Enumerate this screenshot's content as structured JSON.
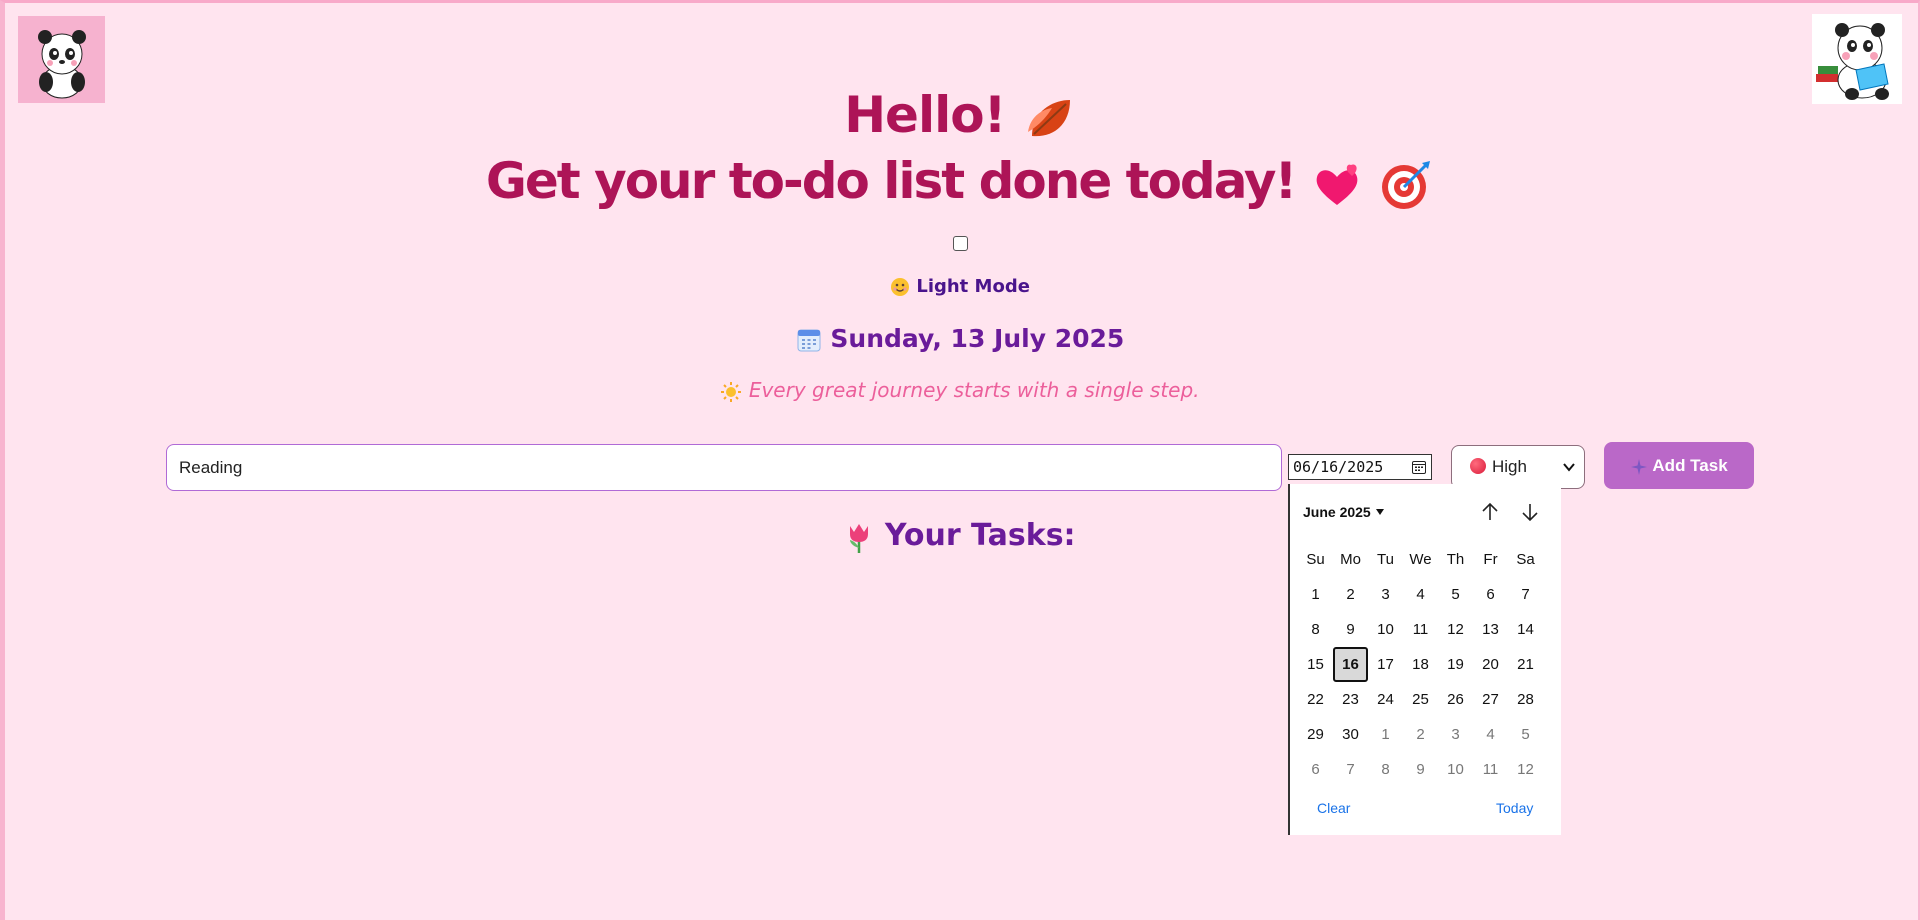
{
  "header": {
    "greeting": "Hello!",
    "greeting_emoji": "leaf-icon",
    "tagline": "Get your to-do list done today!",
    "tagline_emojis": [
      "sparkling-heart-icon",
      "target-icon"
    ]
  },
  "theme_toggle": {
    "checked": false,
    "label": "Light Mode",
    "icon": "smiling-face-icon"
  },
  "date_display": {
    "icon": "calendar-icon",
    "text": "Sunday, 13 July 2025"
  },
  "quote": {
    "icon": "sun-icon",
    "text": "Every great journey starts with a single step."
  },
  "task_form": {
    "task_value": "Reading",
    "date_value": "06/16/2025",
    "priority_value": "High",
    "priority_icon": "red-circle-icon",
    "add_button_label": "Add Task",
    "add_button_icon": "sparkle-icon"
  },
  "tasks_section": {
    "icon": "tulip-icon",
    "heading": "Your Tasks:"
  },
  "calendar_popup": {
    "month_label": "June 2025",
    "weekdays": [
      "Su",
      "Mo",
      "Tu",
      "We",
      "Th",
      "Fr",
      "Sa"
    ],
    "weeks": [
      [
        "1",
        "2",
        "3",
        "4",
        "5",
        "6",
        "7"
      ],
      [
        "8",
        "9",
        "10",
        "11",
        "12",
        "13",
        "14"
      ],
      [
        "15",
        "16",
        "17",
        "18",
        "19",
        "20",
        "21"
      ],
      [
        "22",
        "23",
        "24",
        "25",
        "26",
        "27",
        "28"
      ],
      [
        "29",
        "30",
        "1",
        "2",
        "3",
        "4",
        "5"
      ],
      [
        "6",
        "7",
        "8",
        "9",
        "10",
        "11",
        "12"
      ]
    ],
    "selected_day": "16",
    "clear_label": "Clear",
    "today_label": "Today"
  },
  "colors": {
    "background": "#ffe4ef",
    "title": "#ad1457",
    "accent_purple": "#6a1b9a",
    "button": "#ba68c8",
    "quote": "#ec5f9b",
    "link": "#1a73e8"
  }
}
